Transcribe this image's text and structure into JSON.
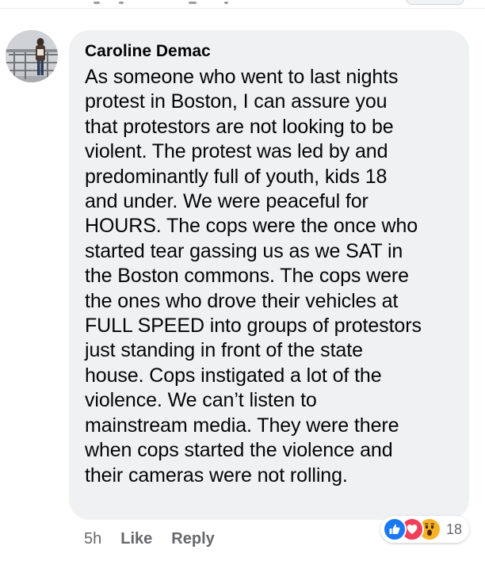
{
  "comment": {
    "author": "Caroline Demac",
    "text_lines": [
      "As someone who went to last nights",
      "protest in Boston, I can assure you",
      "that protestors are not looking to be",
      "violent. The protest was led by and",
      "predominantly full of youth, kids 18",
      "and under. We were peaceful for",
      "HOURS. The cops were the once who",
      "started tear gassing us as we SAT in",
      "the Boston commons. The cops were",
      "the ones who drove their vehicles at",
      "FULL SPEED into groups of protestors",
      "just standing in front of the state",
      "house. Cops instigated a lot of the",
      "violence. We can’t listen to",
      "mainstream media. They were there",
      "when cops started the violence and",
      "their cameras were not rolling."
    ],
    "bubble_color": "#f0f1f3"
  },
  "actions": {
    "timestamp": "5h",
    "like_label": "Like",
    "reply_label": "Reply"
  },
  "reactions": {
    "icons": [
      "like-icon",
      "love-icon",
      "wow-icon"
    ],
    "count": "18",
    "like_color": "#1877f2",
    "love_color": "#f33e58",
    "wow_color": "#f7b125"
  }
}
